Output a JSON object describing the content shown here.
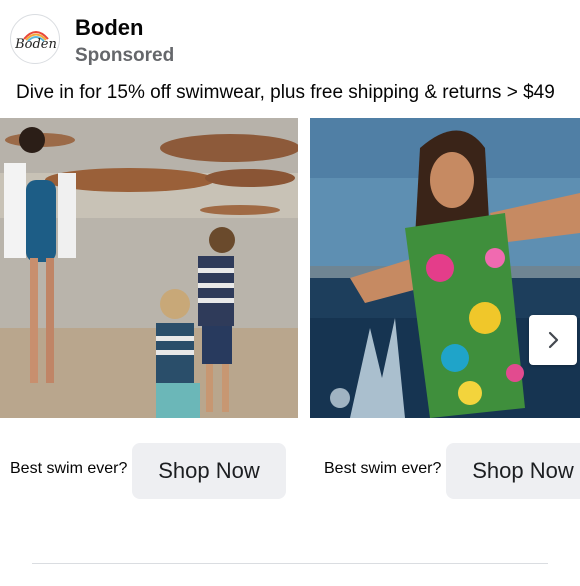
{
  "post": {
    "brand": "Boden",
    "logo_text": "Boden",
    "sponsored": "Sponsored",
    "caption": "Dive in for 15% off swimwear, plus free shipping & returns > $49"
  },
  "carousel": {
    "cards": [
      {
        "cta_text": "Best swim ever?",
        "button_label": "Shop Now",
        "image": "beach-family-photo"
      },
      {
        "cta_text": "Best swim ever?",
        "button_label": "Shop Now",
        "image": "woman-splashing-water-photo"
      }
    ],
    "next_icon": "chevron-right-icon"
  },
  "colors": {
    "text": "#050505",
    "secondary_text": "#65676b",
    "button_bg": "#eeeff2"
  }
}
